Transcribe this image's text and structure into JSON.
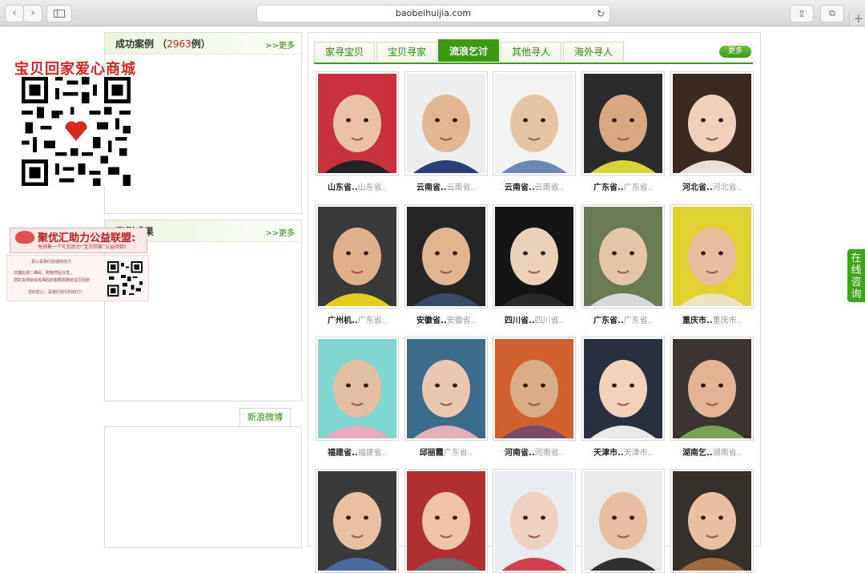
{
  "browser": {
    "url": "baobeihuijia.com",
    "back_icon": "‹",
    "forward_icon": "›",
    "reload_icon": "↻",
    "share_icon": "⇪",
    "tabs_icon": "⧉",
    "newtab_icon": "+"
  },
  "left": {
    "success": {
      "title": "成功案例",
      "count_open": "（",
      "count": "2963",
      "count_close": "例）",
      "more": ">>更多"
    },
    "results": {
      "title": "案例成果",
      "more": ">>更多"
    },
    "weibo_tab": "新浪微博"
  },
  "ads": {
    "mall_title": "宝贝回家爱心商城",
    "banner_title": "聚优汇助力公益联盟:",
    "banner_sub": "每销售一个礼包助力“宝贝回家”公益项目!",
    "promo_lines": [
      "爱心是我们前进的动力",
      "扫描右侧二维码，购物然后分享，",
      "您的支持就会有相应的金额捐赠给宝贝回家",
      "您的爱心，是我们前行的动力!"
    ]
  },
  "tabs": [
    {
      "label": "家寻宝贝",
      "active": false
    },
    {
      "label": "宝贝寻家",
      "active": false
    },
    {
      "label": "流浪乞讨",
      "active": true
    },
    {
      "label": "其他寻人",
      "active": false
    },
    {
      "label": "海外寻人",
      "active": false
    }
  ],
  "more_button": "更多",
  "grid": [
    {
      "name": "山东省..",
      "origin": "山东省.."
    },
    {
      "name": "云南省..",
      "origin": "云南省.."
    },
    {
      "name": "云南省..",
      "origin": "云南省.."
    },
    {
      "name": "广东省..",
      "origin": "广东省.."
    },
    {
      "name": "河北省..",
      "origin": "河北省.."
    },
    {
      "name": "广州机..",
      "origin": "广东省.."
    },
    {
      "name": "安徽省..",
      "origin": "安徽省.."
    },
    {
      "name": "四川省..",
      "origin": "四川省.."
    },
    {
      "name": "广东省..",
      "origin": "广东省.."
    },
    {
      "name": "重庆市..",
      "origin": "重庆市.."
    },
    {
      "name": "福建省..",
      "origin": "福建省.."
    },
    {
      "name": "邱丽霞",
      "origin": "广东省.."
    },
    {
      "name": "河南省..",
      "origin": "河南省.."
    },
    {
      "name": "天津市..",
      "origin": "天津市.."
    },
    {
      "name": "湖南乞..",
      "origin": "湖南省.."
    },
    {
      "name": "",
      "origin": ""
    },
    {
      "name": "",
      "origin": ""
    },
    {
      "name": "",
      "origin": ""
    },
    {
      "name": "",
      "origin": ""
    },
    {
      "name": "",
      "origin": ""
    }
  ],
  "consult": "在线咨询",
  "colors": {
    "accent": "#3c9a12",
    "red": "#d21f1f"
  },
  "icons": {
    "photo": "child-photo-icon",
    "qr": "qr-code-icon"
  }
}
